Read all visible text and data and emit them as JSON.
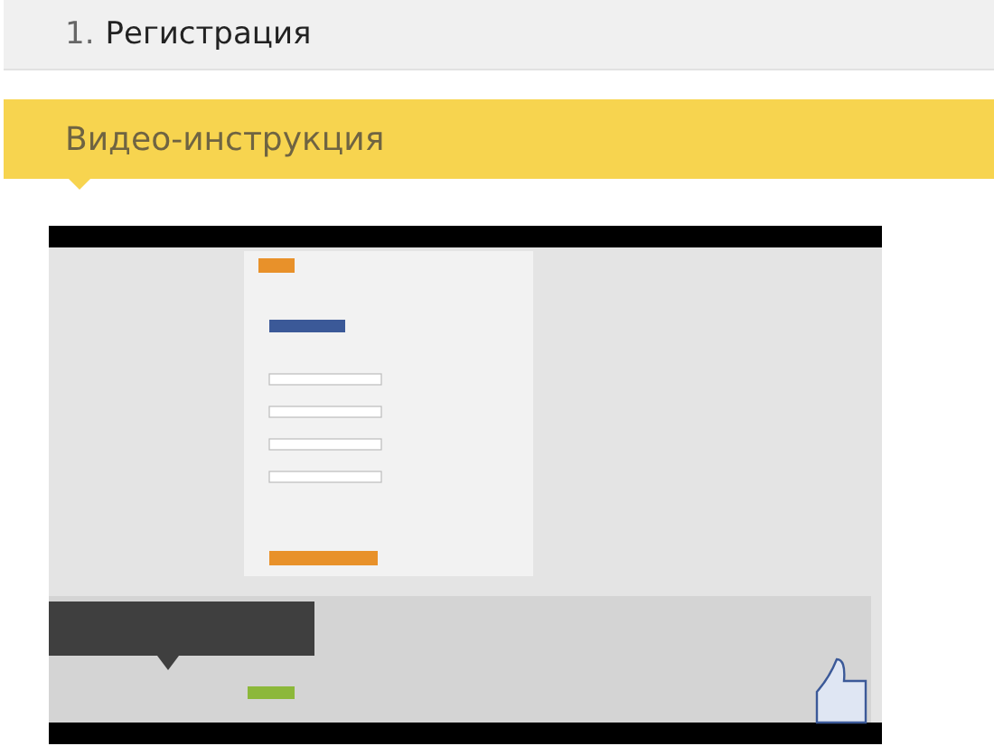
{
  "step": {
    "number": "1.",
    "title": "Регистрация"
  },
  "section": {
    "title": "Видео-инструкция"
  }
}
